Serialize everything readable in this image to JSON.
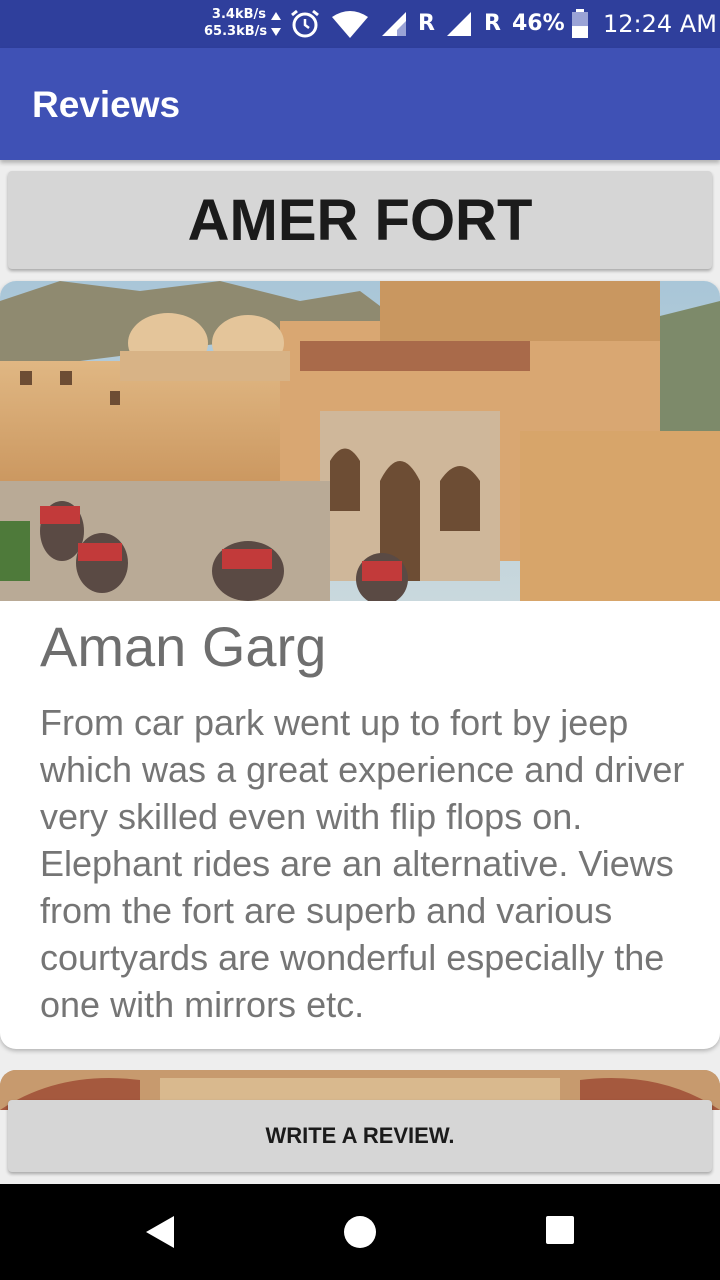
{
  "status_bar": {
    "net_up": "3.4kB/s",
    "net_down": "65.3kB/s",
    "roaming_1": "R",
    "roaming_2": "R",
    "battery_percent": "46%",
    "battery_level": 0.46,
    "time": "12:24 AM",
    "icons": [
      "data-arrows-icon",
      "alarm-icon",
      "wifi-icon",
      "signal-icon",
      "battery-icon"
    ]
  },
  "app_bar": {
    "title": "Reviews"
  },
  "place": {
    "name": "AMER FORT"
  },
  "reviews": [
    {
      "reviewer": "Aman Garg",
      "text": "From car park went up to fort by jeep which was a great experience and driver very skilled even with flip flops on. Elephant rides are an alternative. Views from the fort are superb and various courtyards are wonderful especially the one with mirrors etc."
    }
  ],
  "actions": {
    "write_review": "WRITE A REVIEW."
  },
  "nav_bar": {
    "icons": [
      "back-icon",
      "home-icon",
      "recents-icon"
    ]
  },
  "colors": {
    "status_bar": "#2f3f9c",
    "app_bar": "#3f51b5",
    "button_bg": "#d6d6d6",
    "background": "#eeeeee"
  }
}
